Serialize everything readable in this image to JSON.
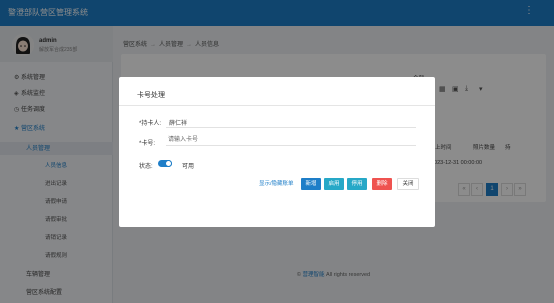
{
  "topbar": {
    "title": "警澄部队营区管理系统",
    "menu_icon": "⋮"
  },
  "user": {
    "name": "admin",
    "tag": "解放军合成235部"
  },
  "sidebar": {
    "items": [
      {
        "label": "系统管理",
        "icon": "gear-icon"
      },
      {
        "label": "系统监控",
        "icon": "shield-icon"
      },
      {
        "label": "任务调度",
        "icon": "clock-icon"
      },
      {
        "label": "营区系统",
        "icon": "star-icon"
      }
    ],
    "sub": [
      {
        "label": "人员管理"
      }
    ],
    "sub2": [
      {
        "label": "人员信息"
      },
      {
        "label": "进出记录"
      },
      {
        "label": "请假申请"
      },
      {
        "label": "请假审批"
      },
      {
        "label": "请销记录"
      },
      {
        "label": "请假规则"
      }
    ],
    "more": [
      {
        "label": "车辆管理"
      },
      {
        "label": "营区系统配置"
      }
    ]
  },
  "breadcrumb": [
    "营区系统",
    "人员管理",
    "人员信息"
  ],
  "table": {
    "headers_right": [
      "全部",
      "上时间",
      "照片数量",
      "持"
    ],
    "row": {
      "date": "2023-12-31 00:00:00"
    }
  },
  "pager": {
    "prev2": "«",
    "prev": "‹",
    "current": "1",
    "next": "›",
    "next2": "»"
  },
  "footer": {
    "prefix": "© ",
    "brand": "营理智能",
    "rest": " All rights reserved"
  },
  "modal": {
    "title": "卡号处理",
    "holder_label": "*持卡人:",
    "holder_value": "薛仁祥",
    "card_label": "*卡号:",
    "card_placeholder": "请输入卡号",
    "status_label": "状态:",
    "status_value": "可用",
    "link_label": "显示/隐藏账单",
    "buttons": [
      {
        "label": "新增",
        "color": "#1e7ec8"
      },
      {
        "label": "启用",
        "color": "#26a8c7"
      },
      {
        "label": "停用",
        "color": "#26a8c7"
      },
      {
        "label": "删除",
        "color": "#ef5350"
      },
      {
        "label": "关闭",
        "color": "#ffffff"
      }
    ]
  }
}
